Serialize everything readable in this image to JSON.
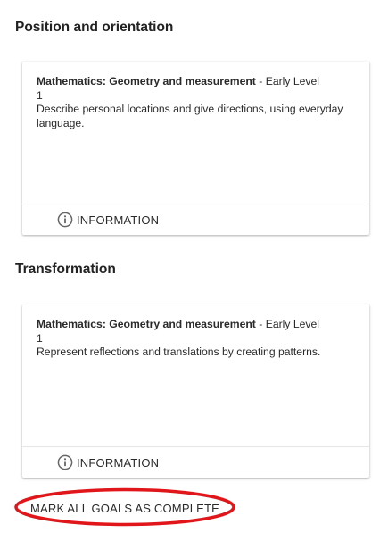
{
  "sections": [
    {
      "title": "Position and orientation",
      "card": {
        "subject": "Mathematics: Geometry and measurement",
        "level": " - Early Level",
        "number": "1",
        "description": "Describe personal locations and give directions, using everyday language.",
        "info_label": "INFORMATION",
        "info_icon": "info-circle-icon"
      }
    },
    {
      "title": "Transformation",
      "card": {
        "subject": "Mathematics: Geometry and measurement",
        "level": " - Early Level",
        "number": "1",
        "description": "Represent reflections and translations by creating patterns.",
        "info_label": "INFORMATION",
        "info_icon": "info-circle-icon"
      }
    }
  ],
  "actions": {
    "mark_all_label": "MARK ALL GOALS AS COMPLETE"
  },
  "colors": {
    "highlight": "#e0161a",
    "text": "#222222"
  }
}
